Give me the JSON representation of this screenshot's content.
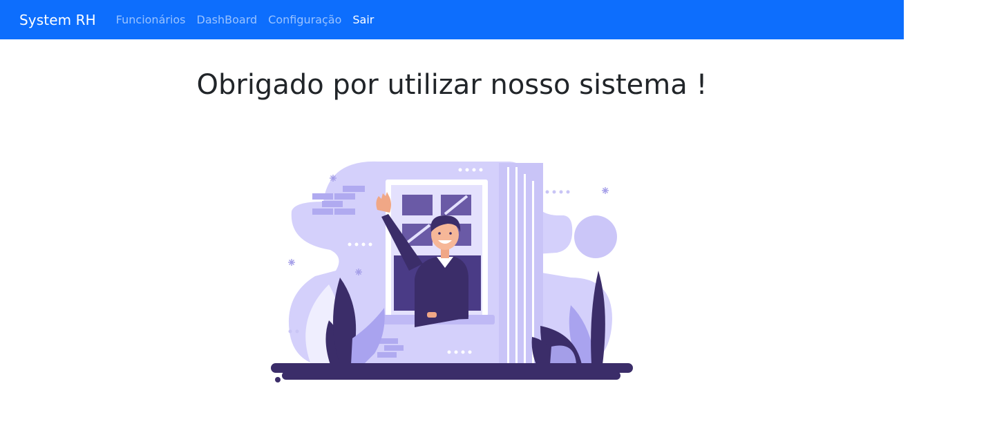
{
  "navbar": {
    "brand": "System RH",
    "links": [
      {
        "label": "Funcionários"
      },
      {
        "label": "DashBoard"
      },
      {
        "label": "Configuração"
      },
      {
        "label": "Sair"
      }
    ]
  },
  "main": {
    "title": "Obrigado por utilizar nosso sistema !"
  },
  "colors": {
    "navbar_bg": "#0d6efd",
    "illustration_light": "#d4d0fb",
    "illustration_mid": "#a9a3ef",
    "illustration_dark": "#3b2d69"
  },
  "illustration": {
    "icon": "waving-man-at-window-illustration"
  }
}
